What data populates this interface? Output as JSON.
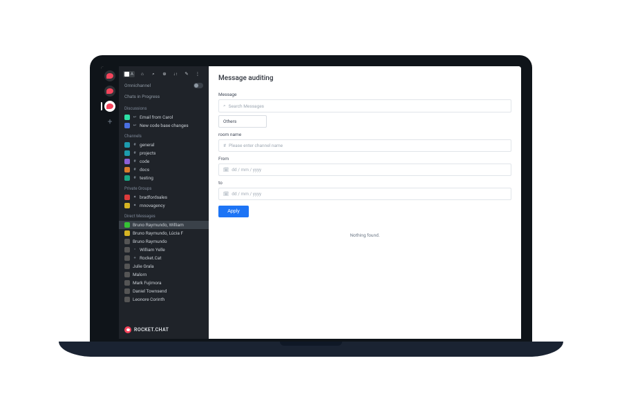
{
  "rail": {
    "servers": [
      "server-1",
      "server-2",
      "server-3"
    ],
    "activeIndex": 2
  },
  "sidebar": {
    "workspace_label": "A",
    "omnichannel_label": "Omnichannel",
    "chats_in_progress_label": "Chats in Progress",
    "sections": {
      "discussions": {
        "header": "Discussions",
        "items": [
          {
            "label": "Email from Carol",
            "chip": "cyan",
            "icn": "↩"
          },
          {
            "label": "New code base changes",
            "chip": "blue",
            "icn": "↩"
          }
        ]
      },
      "channels": {
        "header": "Channels",
        "items": [
          {
            "label": "general",
            "chip": "teal",
            "icn": "#"
          },
          {
            "label": "projects",
            "chip": "teal",
            "icn": "#"
          },
          {
            "label": "code",
            "chip": "purple",
            "icn": "#"
          },
          {
            "label": "docs",
            "chip": "orange",
            "icn": "#"
          },
          {
            "label": "testing",
            "chip": "dteal",
            "icn": "#"
          }
        ]
      },
      "private": {
        "header": "Private Groups",
        "items": [
          {
            "label": "bradfordsales",
            "chip": "red",
            "icn": "✦"
          },
          {
            "label": "mnovagency",
            "chip": "yellow",
            "icn": "✦"
          }
        ]
      },
      "dms": {
        "header": "Direct Messages",
        "items": [
          {
            "label": "Bruno Raymundo, William",
            "chip": "green",
            "selected": true
          },
          {
            "label": "Bruno Raymundo, Lúcia F",
            "chip": "yellow"
          },
          {
            "label": "Bruno Raymundo"
          },
          {
            "label": "William Yelle",
            "status": "•"
          },
          {
            "label": "Rocket.Cat",
            "status": "+"
          },
          {
            "label": "Julie Grala"
          },
          {
            "label": "Malorn"
          },
          {
            "label": "Mark Fujimora"
          },
          {
            "label": "Daniel Townsend"
          },
          {
            "label": "Leonore Corinth"
          }
        ]
      }
    },
    "footer_brand": "ROCKET.CHAT"
  },
  "main": {
    "title": "Message auditing",
    "message_label": "Message",
    "message_placeholder": "Search Messages",
    "others_label": "Others",
    "room_label": "room name",
    "room_placeholder": "Please enter channel name",
    "from_label": "From",
    "to_label": "to",
    "date_placeholder": "dd / mm / yyyy",
    "apply_label": "Apply",
    "empty_text": "Nothing found."
  }
}
